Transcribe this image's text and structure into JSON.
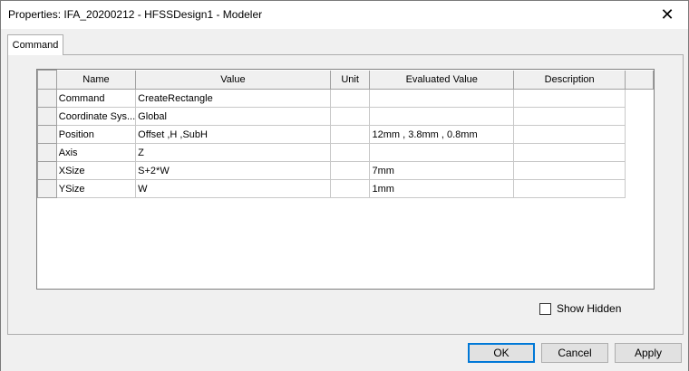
{
  "window": {
    "title": "Properties: IFA_20200212 - HFSSDesign1 - Modeler",
    "close_symbol": "✕"
  },
  "tab": {
    "label": "Command"
  },
  "grid": {
    "columns": [
      "Name",
      "Value",
      "Unit",
      "Evaluated Value",
      "Description"
    ],
    "rows": [
      {
        "name": "Command",
        "value": "CreateRectangle",
        "unit": "",
        "evaluated": "",
        "description": ""
      },
      {
        "name": "Coordinate Sys...",
        "value": "Global",
        "unit": "",
        "evaluated": "",
        "description": ""
      },
      {
        "name": "Position",
        "value": "Offset ,H ,SubH",
        "unit": "",
        "evaluated": "12mm , 3.8mm , 0.8mm",
        "description": ""
      },
      {
        "name": "Axis",
        "value": "Z",
        "unit": "",
        "evaluated": "",
        "description": ""
      },
      {
        "name": "XSize",
        "value": "S+2*W",
        "unit": "",
        "evaluated": "7mm",
        "description": ""
      },
      {
        "name": "YSize",
        "value": "W",
        "unit": "",
        "evaluated": "1mm",
        "description": ""
      }
    ]
  },
  "show_hidden": {
    "label": "Show Hidden",
    "checked": false
  },
  "buttons": {
    "ok": "OK",
    "cancel": "Cancel",
    "apply": "Apply"
  }
}
